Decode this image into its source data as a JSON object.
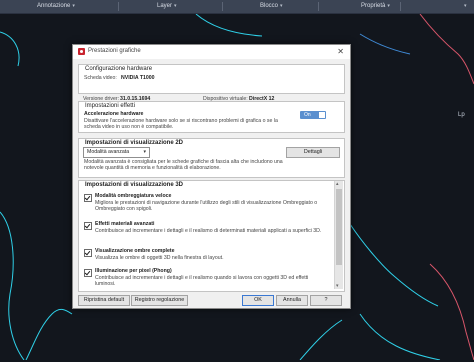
{
  "ribbon": {
    "sections": [
      "Annotazione",
      "Layer",
      "Blocco",
      "Proprietà"
    ],
    "dropdown_icon": "triangle-down-icon"
  },
  "viewport": {
    "label": "Lp"
  },
  "dialog": {
    "title": "Prestazioni grafiche",
    "close_icon": "close-icon",
    "hardware": {
      "header": "Configurazione hardware",
      "video_label": "Scheda video:",
      "video_value": "NVIDIA T1000",
      "driver_label": "Versione driver:",
      "driver_value": "31.0.15.1694",
      "device_label": "Dispositivo virtuale:",
      "device_value": "DirectX 12"
    },
    "effects": {
      "header": "Impostazioni effetti",
      "accel_title": "Accelerazione hardware",
      "accel_desc": "Disattivare l'accelerazione hardware solo se si riscontrano problemi di grafica o se la scheda video in uso non è compatibile.",
      "toggle_label": "On"
    },
    "viz2d": {
      "header": "Impostazioni di visualizzazione 2D",
      "select_value": "Modalità avanzata",
      "details_button": "Dettagli",
      "desc": "Modalità avanzata è consigliata per le schede grafiche di fascia alta che includono una notevole quantità di memoria e funzionalità di elaborazione."
    },
    "viz3d": {
      "header": "Impostazioni di visualizzazione 3D",
      "options": [
        {
          "title": "Modalità ombreggiatura veloce",
          "desc": "Migliora le prestazioni di navigazione durante l'utilizzo degli stili di visualizzazione Ombreggiato o Ombreggiato con spigoli.",
          "checked": true
        },
        {
          "title": "Effetti materiali avanzati",
          "desc": "Contribuisce ad incrementare i dettagli e il realismo di determinati materiali applicati a superfici 3D.",
          "checked": true
        },
        {
          "title": "Visualizzazione ombre complete",
          "desc": "Visualizza le ombre di oggetti 3D nella finestra di layout.",
          "checked": true
        },
        {
          "title": "Illuminazione per pixel (Phong)",
          "desc": "Contribuisce ad incrementare i dettagli e il realismo quando si lavora con oggetti 3D ed effetti luminosi.",
          "checked": true
        }
      ]
    },
    "footer": {
      "reset_button": "Ripristina default",
      "log_button": "Registro regolazione",
      "ok_button": "OK",
      "cancel_button": "Annulla",
      "help_button": "?"
    }
  },
  "colors": {
    "accent": "#5a8fcf",
    "ribbon": "#3b4454",
    "canvas": "#12161d",
    "cyan_line": "#2fd0e8",
    "pink_line": "#d8566a"
  }
}
